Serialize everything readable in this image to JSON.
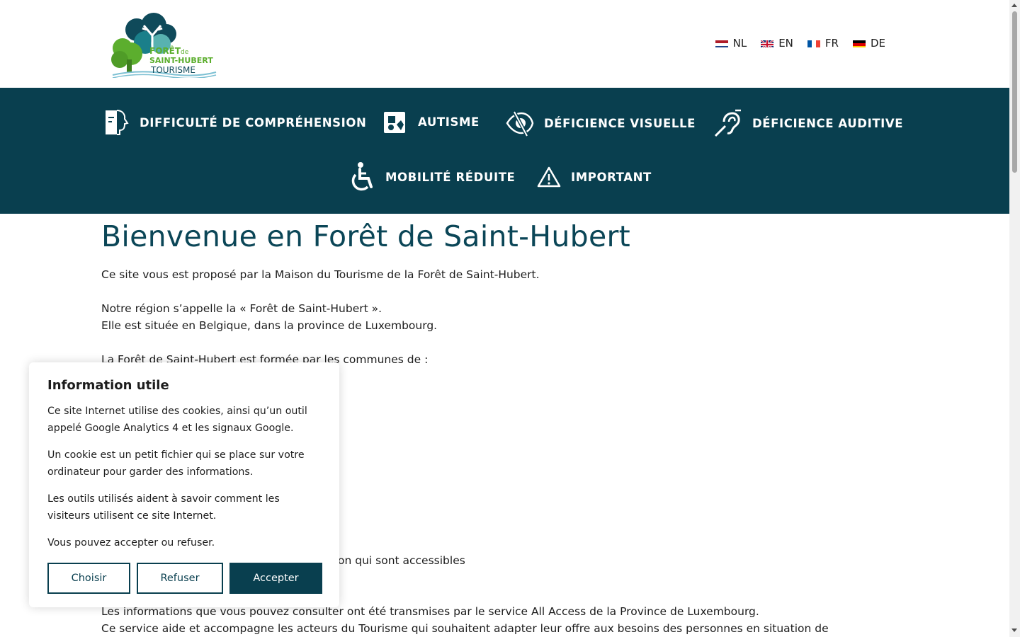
{
  "header": {
    "logo": {
      "line1": "FORÊT",
      "line1_suffix": "de",
      "line2": "SAINT-HUBERT",
      "line3": "TOURISME"
    },
    "languages": [
      {
        "code": "NL",
        "flag": "netherlands-flag-icon"
      },
      {
        "code": "EN",
        "flag": "uk-flag-icon"
      },
      {
        "code": "FR",
        "flag": "france-flag-icon"
      },
      {
        "code": "DE",
        "flag": "germany-flag-icon"
      }
    ]
  },
  "nav": {
    "items": [
      {
        "label": "DIFFICULTÉ DE COMPRÉHENSION",
        "icon": "easy-to-read-icon"
      },
      {
        "label": "AUTISME",
        "icon": "autism-icon"
      },
      {
        "label": "DÉFICIENCE VISUELLE",
        "icon": "visual-impairment-icon"
      },
      {
        "label": "DÉFICIENCE AUDITIVE",
        "icon": "hearing-impairment-icon"
      },
      {
        "label": "MOBILITÉ RÉDUITE",
        "icon": "wheelchair-icon"
      },
      {
        "label": "IMPORTANT",
        "icon": "warning-icon"
      }
    ]
  },
  "main": {
    "title": "Bienvenue en Forêt de Saint-Hubert",
    "p1": "Ce site vous est proposé par la Maison du Tourisme de la Forêt de Saint-Hubert.",
    "p2a": "Notre région s’appelle la « Forêt de Saint-Hubert ».",
    "p2b": "Elle est située en Belgique, dans la province de Luxembourg.",
    "p3": "La Forêt de Saint-Hubert est formée par les communes de :",
    "p4_partial": "on qui sont accessibles",
    "p5a": "Les informations que vous pouvez consulter ont été transmises par le service All Access de la Province de Luxembourg.",
    "p5b": "Ce service aide et accompagne les acteurs du Tourisme qui souhaitent adapter leur offre aux besoins des personnes en situation de"
  },
  "cookie": {
    "title": "Information utile",
    "p1": "Ce site Internet utilise des cookies, ainsi qu’un outil appelé Google Analytics 4 et les signaux Google.",
    "p2": "Un cookie est un petit fichier qui se place sur votre ordinateur pour garder des informations.",
    "p3": "Les outils utilisés aident à savoir comment les visiteurs utilisent ce site Internet.",
    "p4": "Vous pouvez accepter ou refuser.",
    "buttons": {
      "choose": "Choisir",
      "refuse": "Refuser",
      "accept": "Accepter"
    }
  },
  "colors": {
    "nav_bg": "#093f4f",
    "title": "#0b4657",
    "logo_green": "#5cae2e",
    "logo_dark": "#0f4a5a"
  }
}
